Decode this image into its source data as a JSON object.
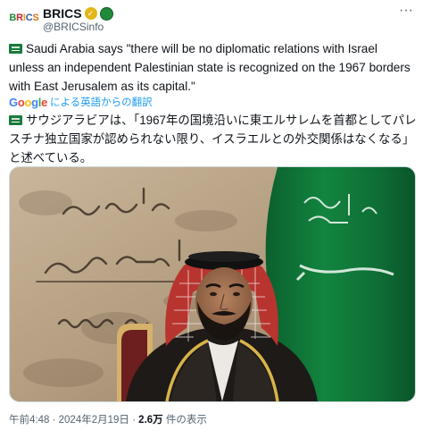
{
  "account": {
    "avatar_letters": [
      "B",
      "R",
      "I",
      "C",
      "S"
    ],
    "name": "BRICS",
    "handle": "@BRICSinfo",
    "verified_icon": "gold-check-badge",
    "affiliation_icon": "green-badge",
    "more_icon": "more-dots-icon"
  },
  "tweet": {
    "text_en": "Saudi Arabia says \"there will be no diplomatic relations with Israel unless an independent Palestinian state is recognized on the 1967 borders with East Jerusalem as its capital.\"",
    "translate_label": "による英語からの翻訳",
    "translate_brand": "Google",
    "text_ja": "サウジアラビアは、「1967年の国境沿いに東エルサレムを首都としてパレスチナ独立国家が認められない限り、イスラエルとの外交関係はなくなる」と述べている。",
    "flag_icon": "saudi-flag-emoji"
  },
  "meta": {
    "time": "午前4:48",
    "separator": "·",
    "date": "2024年2月19日",
    "views_count": "2.6万",
    "views_label": "件の表示"
  },
  "colors": {
    "link": "#1d9bf0",
    "muted": "#536471",
    "flag_green": "#0f7a3a"
  }
}
